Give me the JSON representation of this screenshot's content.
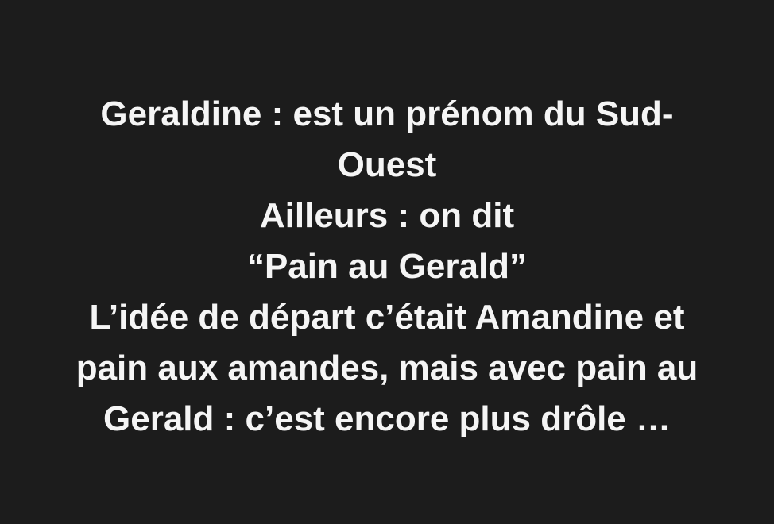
{
  "background_color": "#1c1c1c",
  "text_color": "#f5f5f5",
  "message": {
    "lines": [
      "Geraldine : est un prénom du Sud-",
      "Ouest",
      "Ailleurs : on dit",
      "“Pain au Gerald”",
      "L’idée de départ c’était Amandine et",
      "pain aux amandes, mais avec pain au",
      "Gerald : c’est encore plus drôle …"
    ]
  }
}
